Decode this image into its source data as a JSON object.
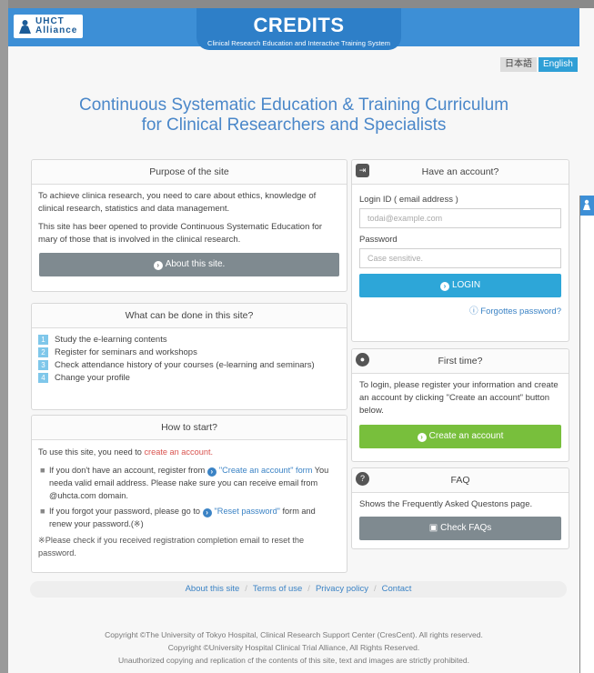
{
  "header": {
    "logo_line1": "UHCT",
    "logo_line2": "Alliance",
    "brand_title": "CREDITS",
    "brand_subtitle": "Clinical Research Education and Interactive Training System",
    "lang_ja": "日本語",
    "lang_en": "English"
  },
  "hero": {
    "line1": "Continuous Systematic Education & Training Curriculum",
    "line2": "for Clinical Researchers and Specialists"
  },
  "purpose": {
    "title": "Purpose of the site",
    "para1": "To achieve clinica research, you need to care about ethics, knowledge of clinical research, statistics and data management.",
    "para2": "This site has beer opened to provide Continuous Systematic Education for mary of those that is involved in the clinical research.",
    "button": "About this site."
  },
  "whatcan": {
    "title": "What can be done in this site?",
    "items": [
      {
        "num": "1",
        "text": "Study the e-learning contents"
      },
      {
        "num": "2",
        "text": "Register for seminars and workshops"
      },
      {
        "num": "3",
        "text": "Check attendance history of your courses (e-learning and seminars)"
      },
      {
        "num": "4",
        "text": "Change your profile"
      }
    ]
  },
  "howto": {
    "title": "How to start?",
    "intro_prefix": "To use this site, you need to ",
    "intro_link": "create an account.",
    "b1_prefix": "If you don't have an account, register from ",
    "b1_link": "\"Create an account\" form",
    "b1_suffix": " You needa valid email address. Please nake sure you can receive email from @uhcta.com domain.",
    "b2_prefix": "If you forgot your password, please go to ",
    "b2_link": "\"Reset password\"",
    "b2_suffix": " form and renew your password.(※)",
    "note": "※Please check if you received registration completion email to reset the password."
  },
  "login": {
    "title": "Have an account?",
    "id_label": "Login ID ( email address )",
    "id_placeholder": "todai@example.com",
    "pw_label": "Password",
    "pw_placeholder": "Case sensitive.",
    "button": "LOGIN",
    "forgot": "Forgottes password?"
  },
  "firsttime": {
    "title": "First time?",
    "text": "To login, please register your information and create an account by clicking \"Create an account\" button below.",
    "button": "Create an account"
  },
  "faq": {
    "title": "FAQ",
    "text": "Shows the Frequently Asked Questons page.",
    "button": "Check FAQs"
  },
  "footer": {
    "links": [
      "About this site",
      "Terms of use",
      "Privacy policy",
      "Contact"
    ],
    "copyright1": "Copyright ©The University of Tokyo Hospital, Clinical Research Support Center (CresCent). All rights reserved.",
    "copyright2": "Copyright ©University Hospital Clinical Trial Alliance, All Rights Reserved.",
    "copyright3": "Unauthorized copying and replication cf the contents of this site, text and images are strictly prohibited."
  },
  "colors": {
    "header_blue": "#3d8fd6",
    "hero_text": "#4a87c9",
    "login_button": "#2da6d8",
    "create_button": "#78bf3c",
    "gray_button": "#7f8a90",
    "link": "#3b83c5",
    "alert_red": "#d9534f"
  }
}
